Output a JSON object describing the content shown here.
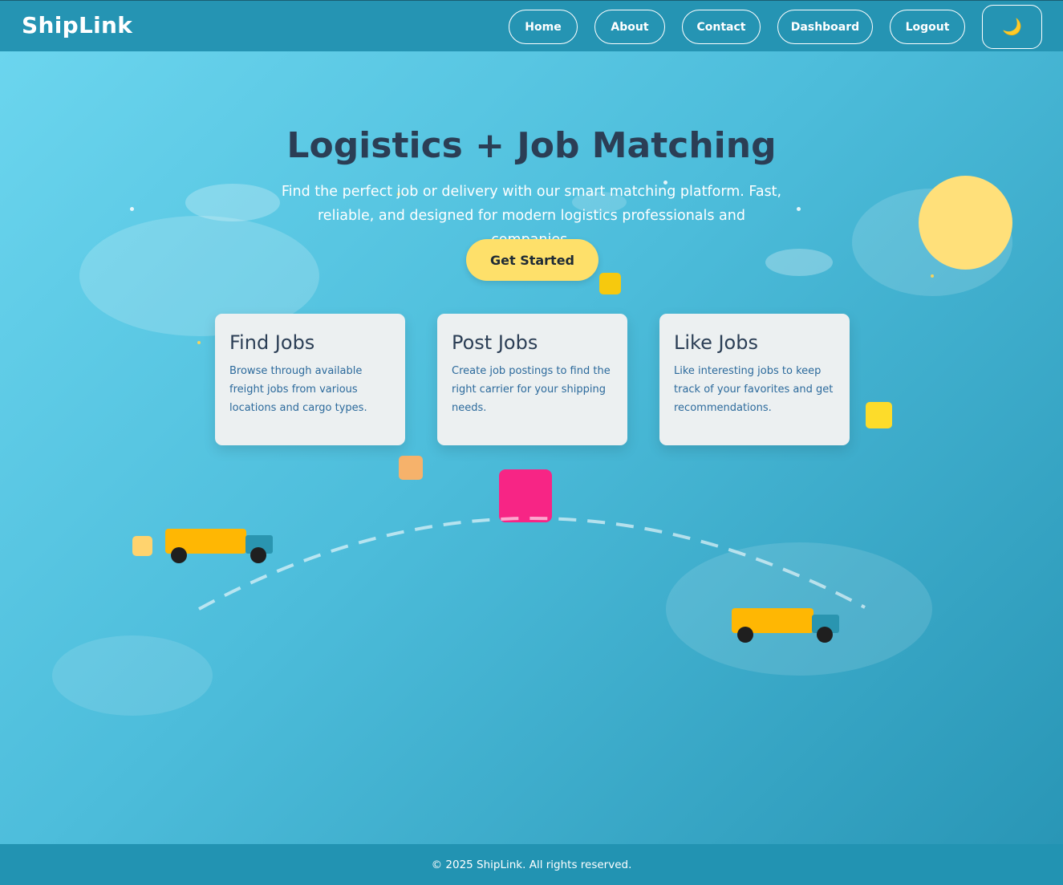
{
  "brand": {
    "name": "ShipLink"
  },
  "nav": {
    "items": [
      {
        "label": "Home"
      },
      {
        "label": "About"
      },
      {
        "label": "Contact"
      },
      {
        "label": "Dashboard"
      },
      {
        "label": "Logout"
      }
    ],
    "theme_toggle_icon": "moon-icon"
  },
  "hero": {
    "title": "Logistics + Job Matching",
    "subtitle": "Find the perfect job or delivery with our smart matching platform. Fast, reliable, and designed for modern logistics professionals and companies.",
    "cta_label": "Get Started"
  },
  "features": [
    {
      "title": "Find Jobs",
      "text": "Browse through available freight jobs from various locations and cargo types."
    },
    {
      "title": "Post Jobs",
      "text": "Create job postings to find the right carrier for your shipping needs."
    },
    {
      "title": "Like Jobs",
      "text": "Like interesting jobs to keep track of your favorites and get recommendations."
    }
  ],
  "footer": {
    "text": "© 2025 ShipLink. All rights reserved."
  },
  "colors": {
    "nav_bg": "#2594b3",
    "hero_start": "#6bd5ee",
    "hero_end": "#2996b6",
    "cta_bg": "#fee06a",
    "card_bg": "#ecf0f1",
    "title_text": "#2b3e55",
    "card_text": "#2c6a9c",
    "truck_body": "#ffb703",
    "truck_cab": "#2a95b0",
    "sun": "#ffe07a",
    "accent_pink": "#f72585"
  }
}
